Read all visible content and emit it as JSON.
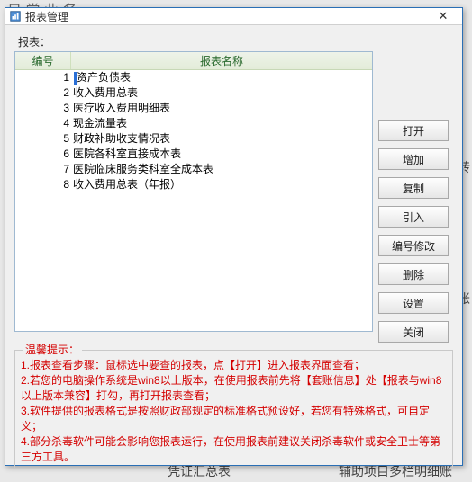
{
  "bg": {
    "tl": "日 常 业 务",
    "r1": "辅助项目多栏明细账",
    "r2": "凭证汇总表",
    "side1": "转",
    "side2": "账"
  },
  "dialog": {
    "title": "报表管理",
    "top_label": "报表：",
    "columns": {
      "id": "编号",
      "name": "报表名称"
    },
    "rows": [
      {
        "id": "1",
        "name": "资产负债表"
      },
      {
        "id": "2",
        "name": "收入费用总表"
      },
      {
        "id": "3",
        "name": "医疗收入费用明细表"
      },
      {
        "id": "4",
        "name": "现金流量表"
      },
      {
        "id": "5",
        "name": "财政补助收支情况表"
      },
      {
        "id": "6",
        "name": "医院各科室直接成本表"
      },
      {
        "id": "7",
        "name": "医院临床服务类科室全成本表"
      },
      {
        "id": "8",
        "name": "收入费用总表（年报）"
      }
    ],
    "buttons": {
      "open": "打开",
      "add": "增加",
      "copy": "复制",
      "import": "引入",
      "renum": "编号修改",
      "delete": "删除",
      "settings": "设置",
      "close": "关闭"
    },
    "hints": {
      "legend": "温馨提示：",
      "l1": "1.报表查看步骤：鼠标选中要查的报表，点【打开】进入报表界面查看；",
      "l2": "2.若您的电脑操作系统是win8以上版本，在使用报表前先将【套账信息】处【报表与win8以上版本兼容】打勾，再打开报表查看；",
      "l3": "3.软件提供的报表格式是按照财政部规定的标准格式预设好，若您有特殊格式，可自定义；",
      "l4": "4.部分杀毒软件可能会影响您报表运行，在使用报表前建议关闭杀毒软件或安全卫士等第三方工具。"
    }
  }
}
